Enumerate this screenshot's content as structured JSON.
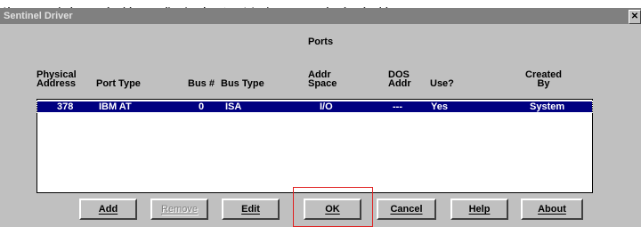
{
  "banner_text": "生寻,则表了安装不成功,如入所,便需要启有安装",
  "window": {
    "title": "Sentinel Driver",
    "close_glyph": "✕"
  },
  "dialog": {
    "heading": "Ports",
    "columns": [
      "Physical\nAddress",
      "Port Type",
      "Bus #",
      "Bus Type",
      "Addr\nSpace",
      "DOS\nAddr",
      "Use?",
      "Created\nBy"
    ],
    "rows": [
      {
        "physical_address": "378",
        "port_type": "IBM AT",
        "bus_num": "0",
        "bus_type": "ISA",
        "addr_space": "I/O",
        "dos_addr": "---",
        "use": "Yes",
        "created_by": "System",
        "selected": true
      }
    ]
  },
  "buttons": {
    "add": "Add",
    "remove": "Remove",
    "edit": "Edit",
    "ok": "OK",
    "cancel": "Cancel",
    "help": "Help",
    "about": "About"
  },
  "colors": {
    "selection": "#000080",
    "dialog_face": "#c0c0c0",
    "annotation_box": "#e02020"
  }
}
